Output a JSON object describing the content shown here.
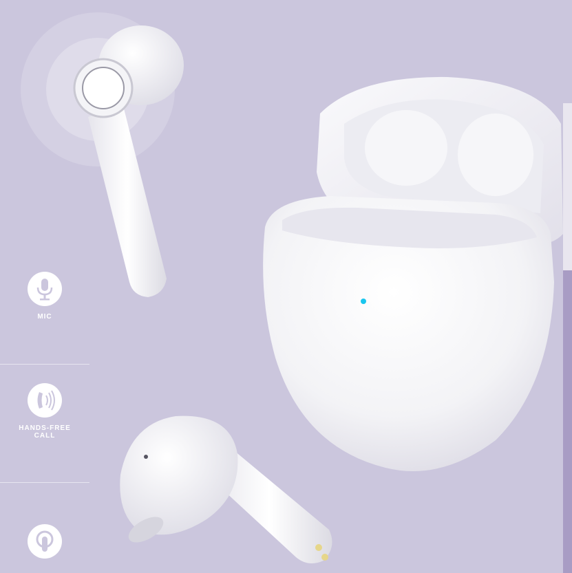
{
  "features": [
    {
      "label": "MIC",
      "icon": "microphone-icon"
    },
    {
      "label": "HANDS-FREE\nCALL",
      "icon": "phone-handset-icon"
    },
    {
      "label": "",
      "icon": "touch-icon"
    }
  ],
  "colors": {
    "background": "#cbc6dd",
    "accent_panel": "#a89cc4",
    "led": "#19c6ee",
    "icon_fill": "#ffffff",
    "icon_glyph": "#cbc6dd"
  }
}
